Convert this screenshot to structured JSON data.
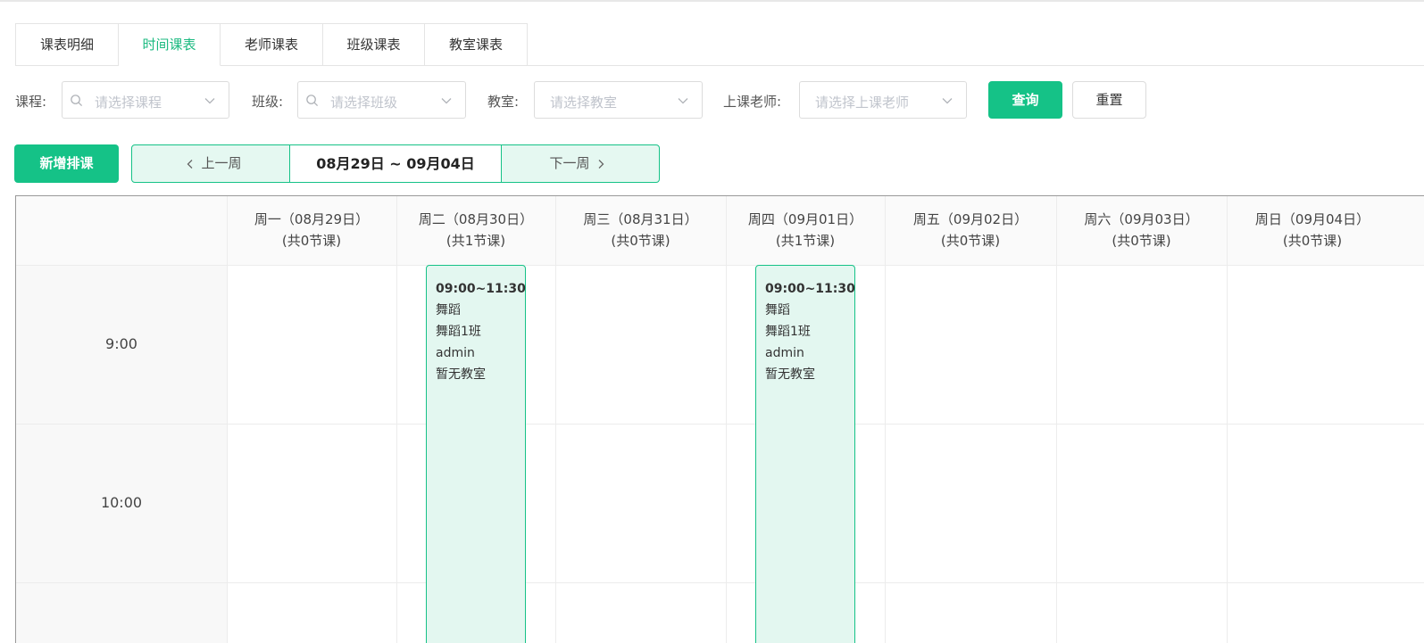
{
  "tabs": [
    "课表明细",
    "时间课表",
    "老师课表",
    "班级课表",
    "教室课表"
  ],
  "active_tab": "时间课表",
  "filters": {
    "course_label": "课程:",
    "course_placeholder": "请选择课程",
    "class_label": "班级:",
    "class_placeholder": "请选择班级",
    "room_label": "教室:",
    "room_placeholder": "请选择教室",
    "teacher_label": "上课老师:",
    "teacher_placeholder": "请选择上课老师",
    "query_label": "查询",
    "reset_label": "重置"
  },
  "toolbar": {
    "add_label": "新增排课",
    "prev_label": "上一周",
    "range_label": "08月29日 ~ 09月04日",
    "next_label": "下一周"
  },
  "days": [
    {
      "title": "周一（08月29日）",
      "count": "(共0节课)"
    },
    {
      "title": "周二（08月30日）",
      "count": "(共1节课)"
    },
    {
      "title": "周三（08月31日）",
      "count": "(共0节课)"
    },
    {
      "title": "周四（09月01日）",
      "count": "(共1节课)"
    },
    {
      "title": "周五（09月02日）",
      "count": "(共0节课)"
    },
    {
      "title": "周六（09月03日）",
      "count": "(共0节课)"
    },
    {
      "title": "周日（09月04日）",
      "count": "(共0节课)"
    }
  ],
  "times": [
    "9:00",
    "10:00"
  ],
  "lessons": [
    {
      "time": "09:00~11:30",
      "course": "舞蹈",
      "class": "舞蹈1班",
      "teacher": "admin",
      "room": "暂无教室"
    },
    {
      "time": "09:00~11:30",
      "course": "舞蹈",
      "class": "舞蹈1班",
      "teacher": "admin",
      "room": "暂无教室"
    }
  ],
  "colors": {
    "accent": "#15c287",
    "accent_light": "#e3f7f0"
  }
}
